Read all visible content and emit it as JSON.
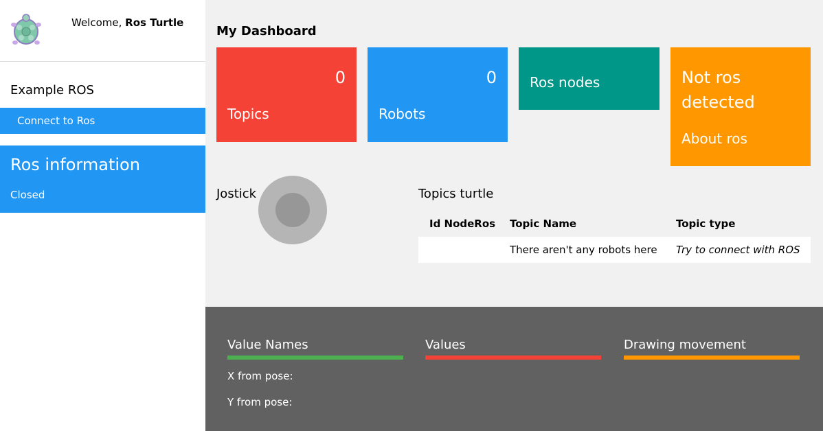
{
  "sidebar": {
    "welcome_prefix": "Welcome, ",
    "user_name": "Ros Turtle",
    "section_title": "Example ROS",
    "connect_label": "Connect to Ros",
    "ros_info_title": "Ros information",
    "ros_status": "Closed"
  },
  "dashboard": {
    "title": "My Dashboard",
    "cards": {
      "topics": {
        "count": "0",
        "label": "Topics",
        "color": "#f44336"
      },
      "robots": {
        "count": "0",
        "label": "Robots",
        "color": "#2196f3"
      },
      "nodes": {
        "label": "Ros nodes",
        "color": "#009688"
      },
      "ros": {
        "status": "Not ros detected",
        "label": "About ros",
        "color": "#ff9800"
      }
    }
  },
  "joystick": {
    "label": "Jostick"
  },
  "topics_table": {
    "title": "Topics turtle",
    "headers": [
      "Id NodeRos",
      "Topic Name",
      "Topic type"
    ],
    "rows": [
      [
        "",
        "There aren't any robots here",
        "Try to connect with ROS"
      ]
    ]
  },
  "footer": {
    "columns": [
      {
        "title": "Value Names",
        "color": "#4caf50"
      },
      {
        "title": "Values",
        "color": "#f44336"
      },
      {
        "title": "Drawing movement",
        "color": "#ff9800"
      }
    ],
    "rows": [
      "X from pose:",
      "Y from pose:"
    ]
  },
  "icons": {
    "avatar": "turtle-icon"
  }
}
